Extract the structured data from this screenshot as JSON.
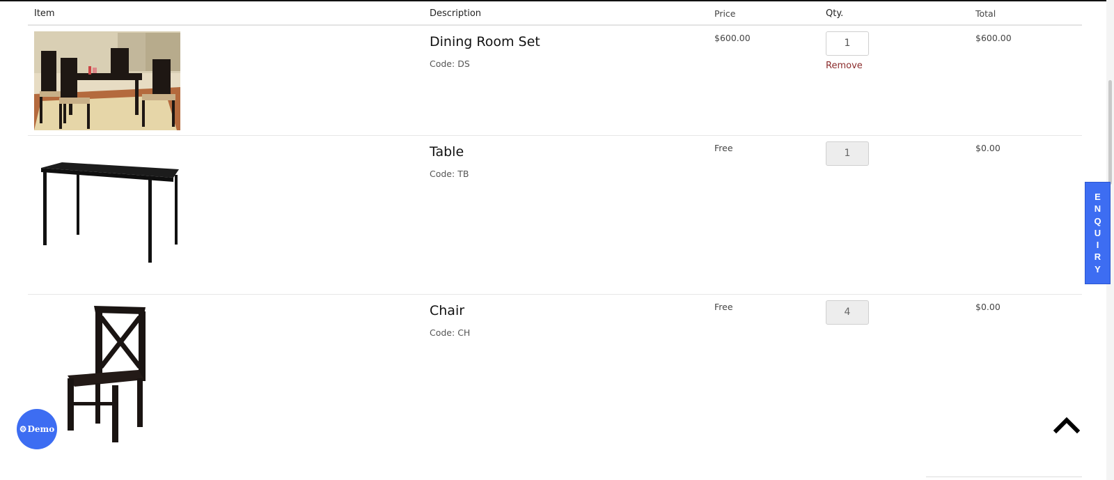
{
  "table": {
    "headers": {
      "item": "Item",
      "description": "Description",
      "price": "Price",
      "qty": "Qty.",
      "total": "Total"
    },
    "rows": [
      {
        "name": "Dining Room Set",
        "code_label": "Code:",
        "code": "DS",
        "price": "$600.00",
        "qty": "1",
        "qty_editable": true,
        "remove_label": "Remove",
        "total": "$600.00",
        "image_icon": "dining-set-photo"
      },
      {
        "name": "Table",
        "code_label": "Code:",
        "code": "TB",
        "price": "Free",
        "qty": "1",
        "qty_editable": false,
        "total": "$0.00",
        "image_icon": "table-photo"
      },
      {
        "name": "Chair",
        "code_label": "Code:",
        "code": "CH",
        "price": "Free",
        "qty": "4",
        "qty_editable": false,
        "total": "$0.00",
        "image_icon": "chair-photo"
      }
    ]
  },
  "enquiry": {
    "letters": [
      "E",
      "N",
      "Q",
      "U",
      "I",
      "R",
      "Y"
    ]
  },
  "demo": {
    "label": "Demo",
    "icon": "gear-icon"
  },
  "scroll_top": {
    "icon": "chevron-up-icon"
  },
  "colors": {
    "accent": "#3d6df2",
    "remove": "#8b2c2c"
  }
}
